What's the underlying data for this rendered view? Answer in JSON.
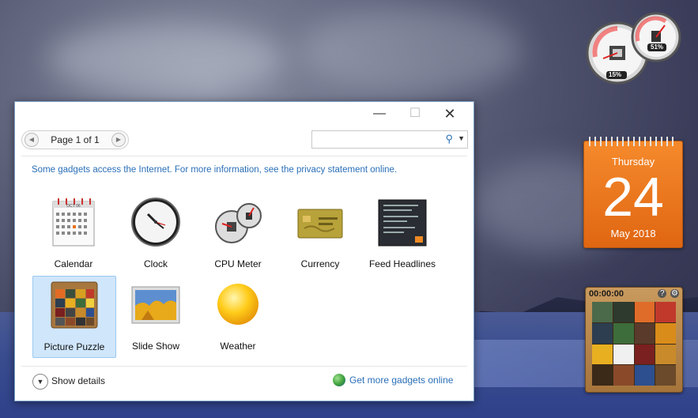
{
  "window": {
    "controls": {
      "minimize": "—",
      "maximize": "☐",
      "close": "✕"
    },
    "pager": {
      "label": "Page 1 of 1",
      "prev": "◀",
      "next": "▶"
    },
    "search": {
      "placeholder": "",
      "dropdown": "▼"
    },
    "info_text": "Some gadgets access the Internet.  For more information, see the privacy statement online.",
    "gadgets": [
      {
        "label": "Calendar",
        "icon": "calendar-icon"
      },
      {
        "label": "Clock",
        "icon": "clock-icon"
      },
      {
        "label": "CPU Meter",
        "icon": "cpu-meter-icon"
      },
      {
        "label": "Currency",
        "icon": "currency-icon"
      },
      {
        "label": "Feed Headlines",
        "icon": "feed-headlines-icon"
      },
      {
        "label": "Picture Puzzle",
        "icon": "picture-puzzle-icon",
        "selected": true
      },
      {
        "label": "Slide Show",
        "icon": "slide-show-icon"
      },
      {
        "label": "Weather",
        "icon": "weather-icon"
      }
    ],
    "calendar_icon_month": "OCT 06",
    "footer": {
      "show_details": "Show details",
      "get_more": "Get more gadgets online"
    }
  },
  "desktop": {
    "cpu_meter": {
      "cpu": "15%",
      "memory": "51%"
    },
    "calendar": {
      "weekday": "Thursday",
      "day": "24",
      "month_year": "May 2018"
    },
    "puzzle": {
      "timer": "00:00:00",
      "help": "?",
      "hint": "⚙"
    }
  },
  "colors": {
    "accent": "#2a6fb8",
    "calendar_orange": "#ee7722",
    "selected_bg": "#cfe6fb"
  }
}
